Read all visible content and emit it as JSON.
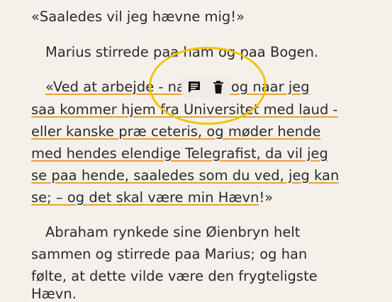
{
  "paragraphs": {
    "p1": "«Saaledes vil jeg hævne mig!»",
    "p2": "Marius stirrede paa ham og paa Bogen.",
    "p3": [
      "«Ved at arbejde - naar du! og naar jeg",
      "saa kommer hjem fra Universitet med laud -",
      "eller kanske præ ceteris, og møder hende",
      "med hendes elendige Telegrafist, da vil jeg",
      "se paa hende, saaledes som du ved, jeg kan",
      "se; – og det skal være min Hævn!»"
    ],
    "p4": [
      "Abraham rynkede sine Øienbryn helt",
      "sammen og stirrede paa Marius; og han",
      "følte, at dette vilde være den frygteligste",
      "Hævn."
    ]
  },
  "toolbar": {
    "note_icon": "note-icon",
    "delete_icon": "trash-icon"
  },
  "colors": {
    "highlight_underline": "#e8a13a",
    "focus_ring": "#f2c211",
    "background": "#f5f1ea"
  }
}
